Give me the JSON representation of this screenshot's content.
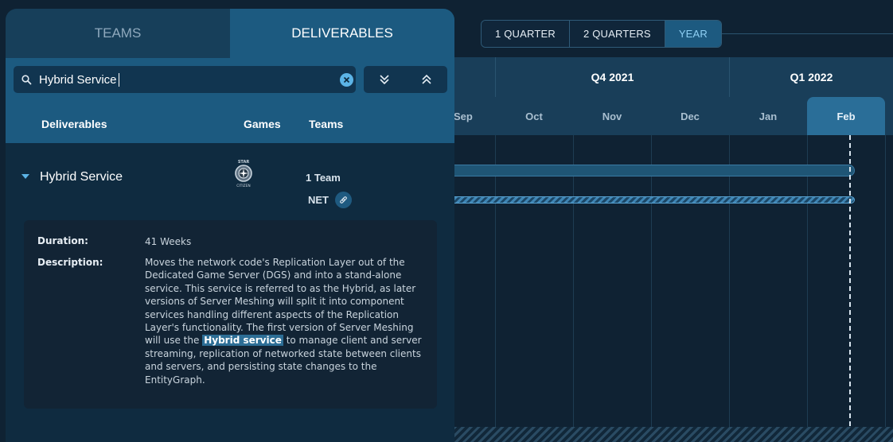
{
  "range_buttons": [
    {
      "label": "1 QUARTER",
      "active": false
    },
    {
      "label": "2 QUARTERS",
      "active": false
    },
    {
      "label": "YEAR",
      "active": true
    }
  ],
  "timeline": {
    "quarters": [
      "Q4 2021",
      "Q1 2022"
    ],
    "months": [
      "Sep",
      "Oct",
      "Nov",
      "Dec",
      "Jan",
      "Feb"
    ],
    "active_month": "Feb"
  },
  "tabs": {
    "teams": "TEAMS",
    "deliverables": "DELIVERABLES"
  },
  "search": {
    "value": "Hybrid Service",
    "icon": "search-icon"
  },
  "columns": {
    "deliverables": "Deliverables",
    "games": "Games",
    "teams": "Teams"
  },
  "deliverable": {
    "title": "Hybrid Service",
    "team_count": "1 Team",
    "team_tag": "NET",
    "game_logo_top": "STAR",
    "game_logo_bottom": "CITIZEN",
    "duration_label": "Duration:",
    "duration_value": "41 Weeks",
    "description_label": "Description:",
    "description_before": "Moves the network code's Replication Layer out of the Dedicated Game Server (DGS) and into a stand-alone service. This service is referred to as the Hybrid, as later versions of Server Meshing will split it into component services handling different aspects of the Replication Layer's functionality. The first version of Server Meshing will use the",
    "description_highlight": "Hybrid service",
    "description_after": "to manage client and server streaming, replication of networked state between clients and servers, and persisting state changes to the EntityGraph."
  },
  "colors": {
    "accent": "#5cb4e6",
    "panel_header": "#1c5a80",
    "background": "#0f2233"
  }
}
